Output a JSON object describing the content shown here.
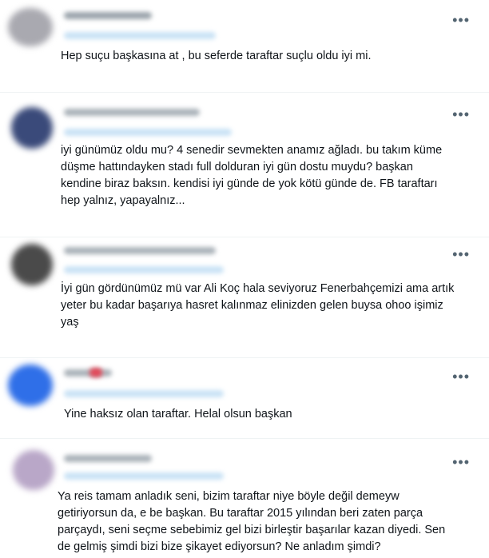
{
  "tweets": [
    {
      "more": "•••",
      "avatar_color": "#a9a9b0",
      "text": "Hep suçu başkasına at , bu seferde taraftar suçlu oldu iyi mi."
    },
    {
      "more": "•••",
      "avatar_color": "#3a4a7a",
      "text": "iyi günümüz oldu mu? 4 senedir sevmekten anamız ağladı. bu takım küme\ndüşme hattındayken stadı full dolduran iyi gün dostu muydu? başkan\nkendine biraz baksın. kendisi iyi günde de yok kötü günde de. FB taraftarı\nhep yalnız, yapayalnız..."
    },
    {
      "more": "•••",
      "avatar_color": "#4a4a4a",
      "text": "İyi gün gördünümüz mü var Ali Koç hala seviyoruz Fenerbahçemizi ama artık\nyeter bu kadar başarıya hasret kalınmaz elinizden gelen buysa ohoo işimiz\nyaş"
    },
    {
      "more": "•••",
      "avatar_color": "#2f6fe8",
      "text": "Yine haksız olan taraftar. Helal olsun başkan"
    },
    {
      "more": "•••",
      "avatar_color": "#b9a7c8",
      "text": "Ya reis tamam anladık seni, bizim taraftar niye böyle değil demeyw\ngetiriyorsun da, e be başkan. Bu taraftar 2015 yılından beri zaten parça\nparçaydı, seni seçme sebebimiz gel bizi birleştir başarılar kazan diyedi. Sen\nde gelmiş şimdi bizi bize şikayet ediyorsun? Ne anladım şimdi?"
    }
  ]
}
